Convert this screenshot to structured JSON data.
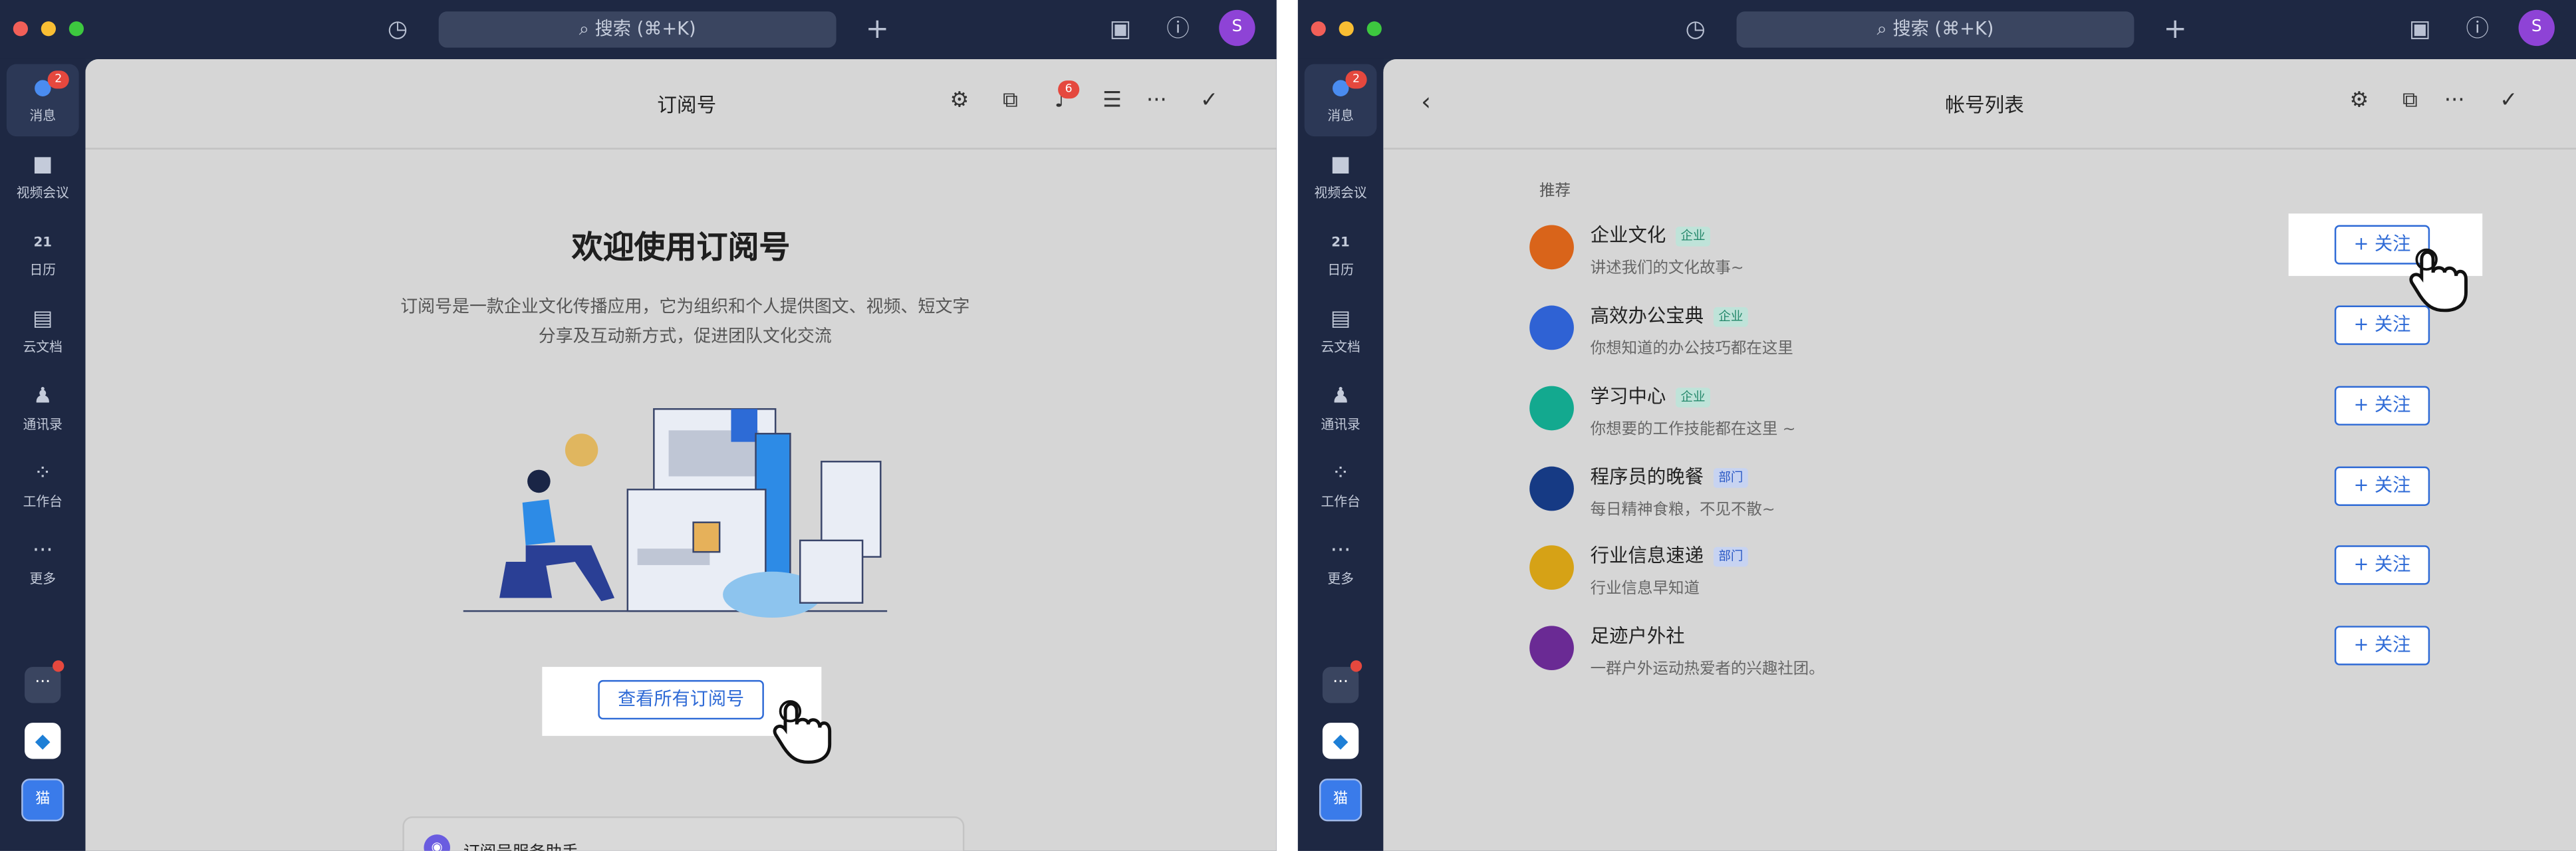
{
  "shared": {
    "search_placeholder": "搜索 (⌘+K)",
    "user_initial": "S",
    "sidebar": [
      {
        "label": "消息",
        "icon": "chat-icon",
        "badge": "2"
      },
      {
        "label": "视频会议",
        "icon": "video-icon"
      },
      {
        "label": "日历",
        "icon": "calendar-icon",
        "glyph": "21"
      },
      {
        "label": "云文档",
        "icon": "document-icon"
      },
      {
        "label": "通讯录",
        "icon": "contacts-icon"
      },
      {
        "label": "工作台",
        "icon": "workspace-icon"
      },
      {
        "label": "更多",
        "icon": "more-icon"
      }
    ],
    "app_tile_label": "猫"
  },
  "left": {
    "title": "订阅号",
    "bell_badge": "6",
    "welcome_title": "欢迎使用订阅号",
    "description": "订阅号是一款企业文化传播应用，它为组织和个人提供图文、视频、短文字分享及互动新方式，促进团队文化交流",
    "view_all_button": "查看所有订阅号",
    "card_title": "订阅号服务助手"
  },
  "right": {
    "title": "帐号列表",
    "section_label": "推荐",
    "follow_label": "关注",
    "accounts": [
      {
        "name": "企业文化",
        "tag": "企业",
        "desc": "讲述我们的文化故事~",
        "color": "#d9641a"
      },
      {
        "name": "高效办公宝典",
        "tag": "企业",
        "desc": "你想知道的办公技巧都在这里",
        "color": "#2f62d4"
      },
      {
        "name": "学习中心",
        "tag": "企业",
        "desc": "你想要的工作技能都在这里 ~",
        "color": "#13a98f"
      },
      {
        "name": "程序员的晚餐",
        "tag": "部门",
        "desc": "每日精神食粮，不见不散~",
        "color": "#163a84"
      },
      {
        "name": "行业信息速递",
        "tag": "部门",
        "desc": "行业信息早知道",
        "color": "#d6a216"
      },
      {
        "name": "足迹户外社",
        "tag": "",
        "desc": "一群户外运动热爱者的兴趣社团。",
        "color": "#6a2a94"
      }
    ]
  }
}
